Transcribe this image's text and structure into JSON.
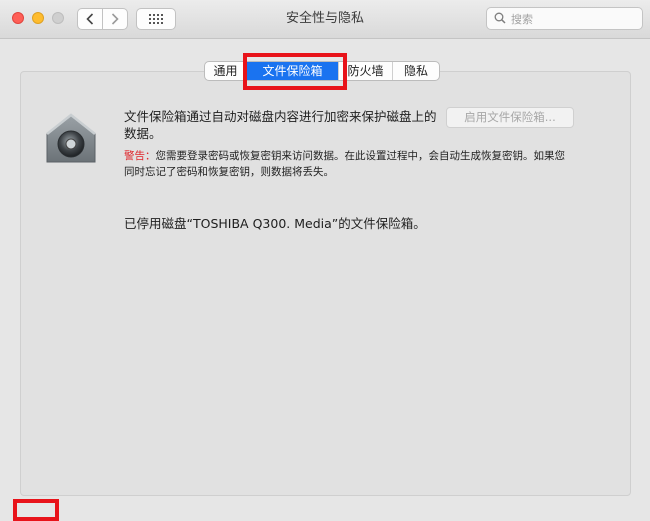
{
  "window": {
    "title": "安全性与隐私"
  },
  "toolbar": {
    "search_placeholder": "搜索"
  },
  "tabs": [
    {
      "label": "通用"
    },
    {
      "label": "文件保险箱"
    },
    {
      "label": "防火墙"
    },
    {
      "label": "隐私"
    }
  ],
  "filevault": {
    "description": "文件保险箱通过自动对磁盘内容进行加密来保护磁盘上的数据。",
    "enable_button": "启用文件保险箱...",
    "warning_label": "警告：",
    "warning_text": "您需要登录密码或恢复密钥来访问数据。在此设置过程中，会自动生成恢复密钥。如果您同时忘记了密码和恢复密钥，则数据将丢失。",
    "status": "已停用磁盘“TOSHIBA Q300. Media”的文件保险箱。"
  },
  "colors": {
    "accent": "#1a73f0",
    "highlight": "#e8131a",
    "warning": "#e0262c"
  },
  "icons": [
    "back-arrow-icon",
    "forward-arrow-icon",
    "show-all-grid-icon",
    "search-icon",
    "lock-house-icon"
  ]
}
